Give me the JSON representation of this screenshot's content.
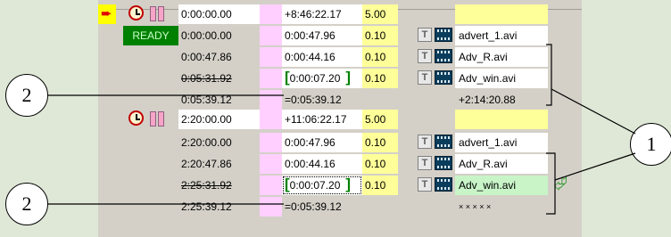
{
  "rows": [
    {
      "type": "header",
      "start": "0:00:00.00",
      "dur": "+8:46:22.17",
      "speed": "5.00"
    },
    {
      "type": "clip",
      "status": "READY",
      "start": "0:00:00.00",
      "dur": "0:00:47.96",
      "speed": "0.10",
      "file": "advert_1.avi"
    },
    {
      "type": "clip",
      "start": "0:00:47.86",
      "dur": "0:00:44.16",
      "speed": "0.10",
      "file": "Adv_R.avi"
    },
    {
      "type": "clip",
      "start": "0:05:31.92",
      "dur": "0:00:07.20",
      "speed": "0.10",
      "file": "Adv_win.avi",
      "strike": true,
      "bracket": true
    },
    {
      "type": "total",
      "start": "0:05:39.12",
      "dur": "=0:05:39.12",
      "extra": "+2:14:20.88"
    },
    {
      "type": "header2",
      "start": "2:20:00.00",
      "dur": "+11:06:22.17",
      "speed": "5.00"
    },
    {
      "type": "clip",
      "start": "2:20:00.00",
      "dur": "0:00:47.96",
      "speed": "0.10",
      "file": "advert_1.avi"
    },
    {
      "type": "clip",
      "start": "2:20:47.86",
      "dur": "0:00:44.16",
      "speed": "0.10",
      "file": "Adv_R.avi"
    },
    {
      "type": "clip",
      "start": "2:25:31.92",
      "dur": "0:00:07.20",
      "speed": "0.10",
      "file": "Adv_win.avi",
      "strike": true,
      "bracket": true,
      "selected": true
    },
    {
      "type": "total",
      "start": "2:25:39.12",
      "dur": "=0:05:39.12",
      "extra": "× × × × ×"
    }
  ],
  "callouts": {
    "two_a": "2",
    "two_b": "2",
    "one": "1"
  },
  "icons": {
    "pointer": "play-arrow-icon",
    "clock": "clock-icon",
    "pause": "pause-icon",
    "text": "text-overlay-icon",
    "film": "film-icon",
    "enter": "enter-arrow-icon"
  },
  "t_label": "T"
}
